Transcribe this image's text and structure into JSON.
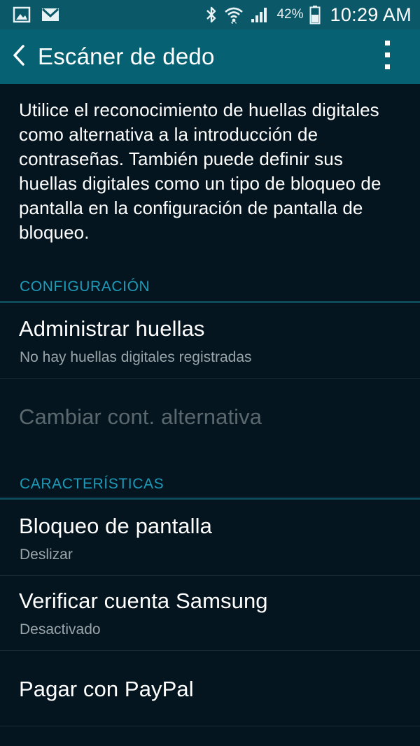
{
  "status_bar": {
    "left_icons": [
      "gallery-icon",
      "gmail-icon"
    ],
    "right_icons": [
      "bluetooth-icon",
      "wifi-icon",
      "signal-icon",
      "battery-icon"
    ],
    "battery": "42%",
    "time": "10:29 AM"
  },
  "app_bar": {
    "title": "Escáner de dedo",
    "back_icon": "chevron-left-icon",
    "menu_icon": "overflow-menu-icon"
  },
  "description": "Utilice el reconocimiento de huellas digitales como alternativa a la introducción de contraseñas. También puede definir sus huellas digitales como un tipo de bloqueo de pantalla en la configuración de pantalla de bloqueo.",
  "sections": {
    "config": {
      "header": "CONFIGURACIÓN",
      "items": [
        {
          "title": "Administrar huellas",
          "subtitle": "No hay huellas digitales registradas",
          "enabled": true
        },
        {
          "title": "Cambiar cont. alternativa",
          "enabled": false
        }
      ]
    },
    "features": {
      "header": "CARACTERÍSTICAS",
      "items": [
        {
          "title": "Bloqueo de pantalla",
          "subtitle": "Deslizar"
        },
        {
          "title": "Verificar cuenta Samsung",
          "subtitle": "Desactivado"
        },
        {
          "title": "Pagar con PayPal"
        }
      ]
    }
  },
  "colors": {
    "background": "#04151f",
    "app_bar": "#066173",
    "status_bar": "#0b5868",
    "accent": "#1d9bb8",
    "secondary_text": "#9aa5aa",
    "disabled_text": "#5b686e"
  }
}
